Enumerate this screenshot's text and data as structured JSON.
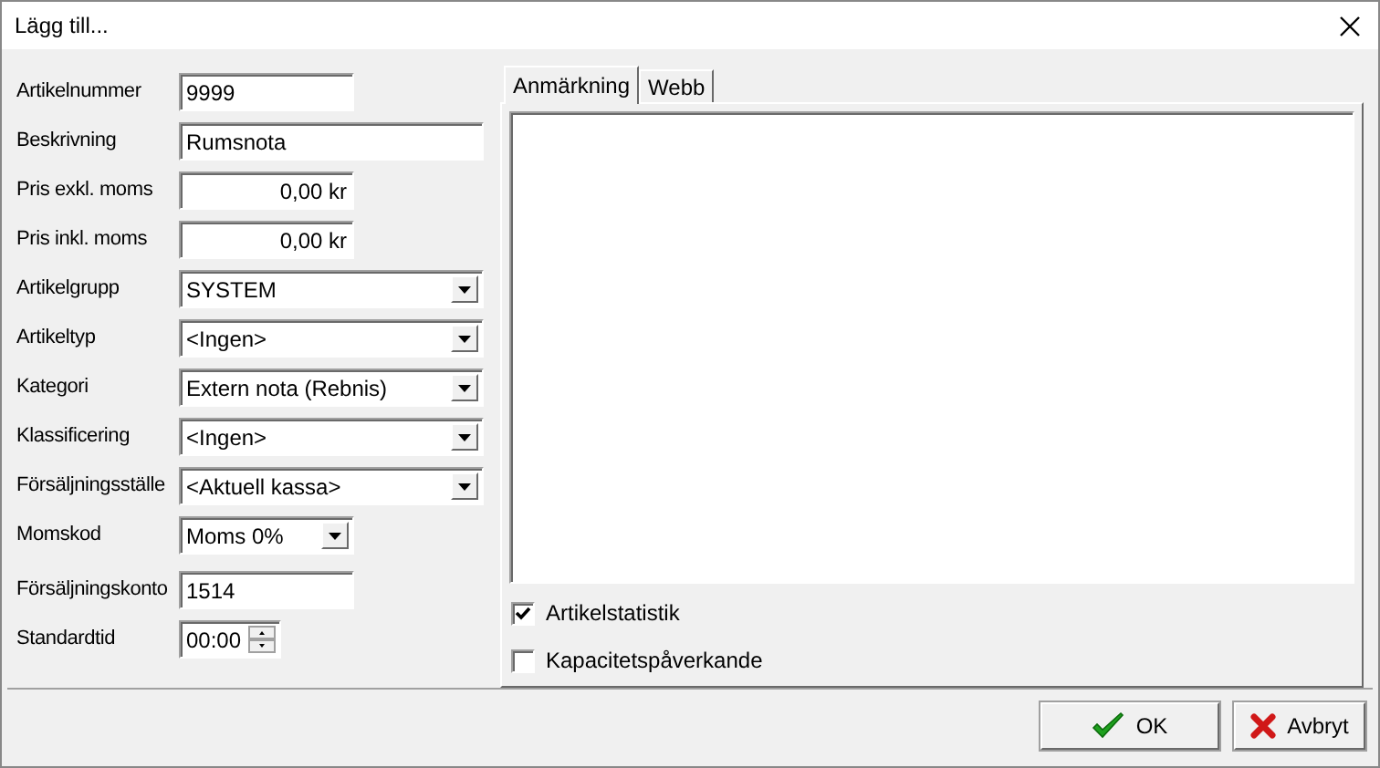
{
  "window": {
    "title": "Lägg till..."
  },
  "fields": [
    {
      "label": "Artikelnummer",
      "kind": "text",
      "value": "9999"
    },
    {
      "label": "Beskrivning",
      "kind": "text",
      "value": "Rumsnota"
    },
    {
      "label": "Pris exkl. moms",
      "kind": "number",
      "value": "0,00 kr"
    },
    {
      "label": "Pris inkl. moms",
      "kind": "number",
      "value": "0,00 kr"
    },
    {
      "label": "Artikelgrupp",
      "kind": "combo",
      "value": "SYSTEM"
    },
    {
      "label": "Artikeltyp",
      "kind": "combo",
      "value": "<Ingen>"
    },
    {
      "label": "Kategori",
      "kind": "combo",
      "value": "Extern nota (Rebnis)"
    },
    {
      "label": "Klassificering",
      "kind": "combo",
      "value": "<Ingen>"
    },
    {
      "label": "Försäljningsställe",
      "kind": "combo",
      "value": "<Aktuell kassa>"
    },
    {
      "label": "Momskod",
      "kind": "combo",
      "value": "Moms 0%"
    },
    {
      "label": "Försäljningskonto",
      "kind": "text",
      "value": "1514"
    },
    {
      "label": "Standardtid",
      "kind": "spin",
      "value": "00:00"
    }
  ],
  "tabs": [
    {
      "label": "Anmärkning",
      "selected": true
    },
    {
      "label": "Webb",
      "selected": false
    }
  ],
  "checkboxes": [
    {
      "label": "Artikelstatistik",
      "checked": true
    },
    {
      "label": "Kapacitetspåverkande",
      "checked": false
    }
  ],
  "buttons": [
    {
      "label": "OK",
      "kind": "ok"
    },
    {
      "label": "Avbryt",
      "kind": "cancel"
    }
  ]
}
